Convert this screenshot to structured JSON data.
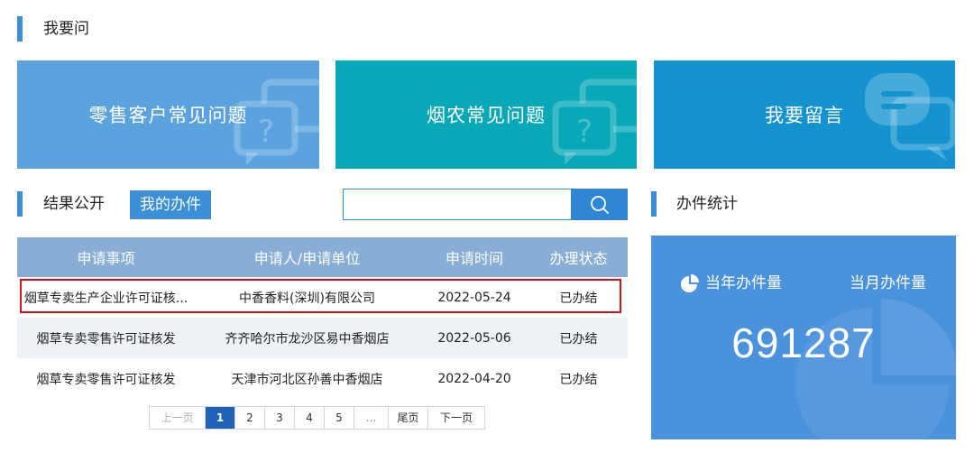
{
  "ask_section": {
    "title": "我要问"
  },
  "cards": [
    {
      "label": "零售客户常见问题",
      "icon": "question-bubble-icon"
    },
    {
      "label": "烟农常见问题",
      "icon": "question-bubble-icon"
    },
    {
      "label": "我要留言",
      "icon": "message-bubble-icon"
    }
  ],
  "results_section": {
    "tab_public": "结果公开",
    "tab_mine": "我的办件",
    "search": {
      "placeholder": "",
      "value": "",
      "button_icon": "search-icon"
    }
  },
  "table": {
    "headers": [
      "申请事项",
      "申请人/申请单位",
      "申请时间",
      "办理状态"
    ],
    "rows": [
      {
        "item": "烟草专卖生产企业许可证核...",
        "applicant": "中香香料(深圳)有限公司",
        "date": "2022-05-24",
        "status": "已办结"
      },
      {
        "item": "烟草专卖零售许可证核发",
        "applicant": "齐齐哈尔市龙沙区易中香烟店",
        "date": "2022-05-06",
        "status": "已办结"
      },
      {
        "item": "烟草专卖零售许可证核发",
        "applicant": "天津市河北区孙善中香烟店",
        "date": "2022-04-20",
        "status": "已办结"
      }
    ]
  },
  "pagination": {
    "prev": "上一页",
    "pages": [
      "1",
      "2",
      "3",
      "4",
      "5"
    ],
    "current": "1",
    "dots": "...",
    "last": "尾页",
    "next": "下一页"
  },
  "stats_section": {
    "title": "办件统计",
    "tab_year": "当年办件量",
    "tab_month": "当月办件量",
    "value": "691287",
    "icon": "pie-chart-icon"
  },
  "colors": {
    "accent": "#3b8fd6",
    "card1": "#5aa3df",
    "card2": "#08a8b9",
    "card3": "#1593cf",
    "table_header": "#88aed6",
    "highlight_border": "#d0121b",
    "stats_bg": "#4a92dc"
  }
}
